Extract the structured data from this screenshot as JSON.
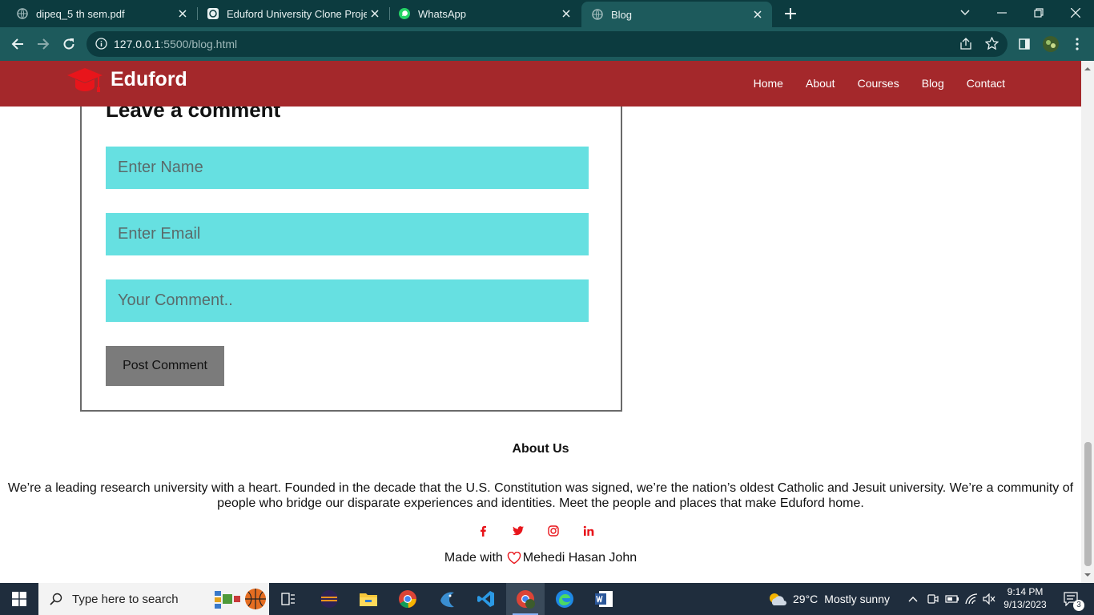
{
  "browser": {
    "tabs": [
      {
        "title": "dipeq_5 th sem.pdf",
        "icon": "globe-icon"
      },
      {
        "title": "Eduford University Clone Project",
        "icon": "chatgpt-icon"
      },
      {
        "title": "WhatsApp",
        "icon": "whatsapp-icon"
      },
      {
        "title": "Blog",
        "icon": "globe-icon",
        "active": true
      }
    ],
    "url_host": "127.0.0.1",
    "url_path": ":5500/blog.html"
  },
  "site": {
    "brand": "Eduford",
    "nav": [
      "Home",
      "About",
      "Courses",
      "Blog",
      "Contact"
    ],
    "accent": "#a4282b",
    "field_color": "#66e0e1"
  },
  "comment_form": {
    "heading": "Leave a comment",
    "name_placeholder": "Enter Name",
    "email_placeholder": "Enter Email",
    "comment_placeholder": "Your Comment..",
    "submit_label": "Post Comment"
  },
  "footer": {
    "about_title": "About Us",
    "about_text": "We’re a leading research university with a heart. Founded in the decade that the U.S. Constitution was signed, we’re the nation’s oldest Catholic and Jesuit university. We’re a community of people who bridge our disparate experiences and identities. Meet the people and places that make Eduford home.",
    "socials": [
      "facebook-icon",
      "twitter-icon",
      "instagram-icon",
      "linkedin-icon"
    ],
    "made_with_prefix": "Made with",
    "made_with_author": "Mehedi Hasan John"
  },
  "taskbar": {
    "search_placeholder": "Type here to search",
    "weather_temp": "29°C",
    "weather_desc": "Mostly sunny",
    "time": "9:14 PM",
    "date": "9/13/2023",
    "notification_count": "3"
  }
}
